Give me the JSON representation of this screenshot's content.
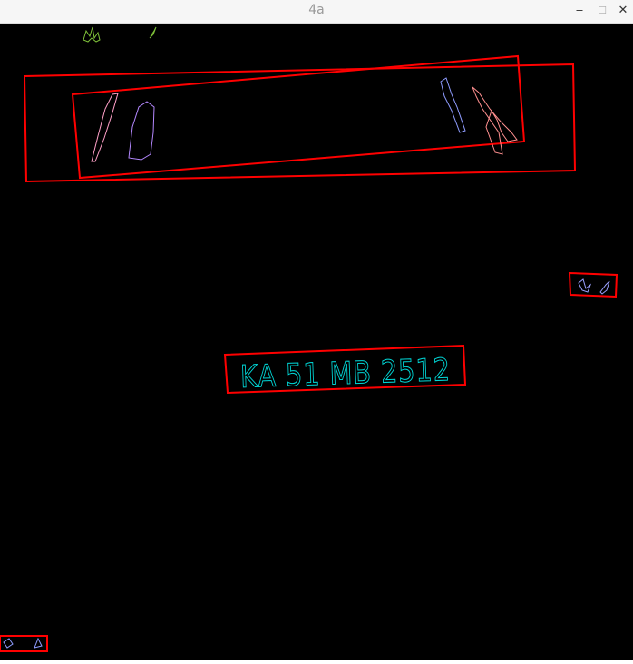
{
  "window": {
    "title": "4a",
    "controls": {
      "minimize": "‒",
      "maximize": "☐",
      "close": "✕"
    }
  },
  "image": {
    "background_color": "#000000",
    "box_color": "#ff0000",
    "plate_text": "KA 51 MB 2512",
    "plate_text_color": "#00d7d7"
  }
}
